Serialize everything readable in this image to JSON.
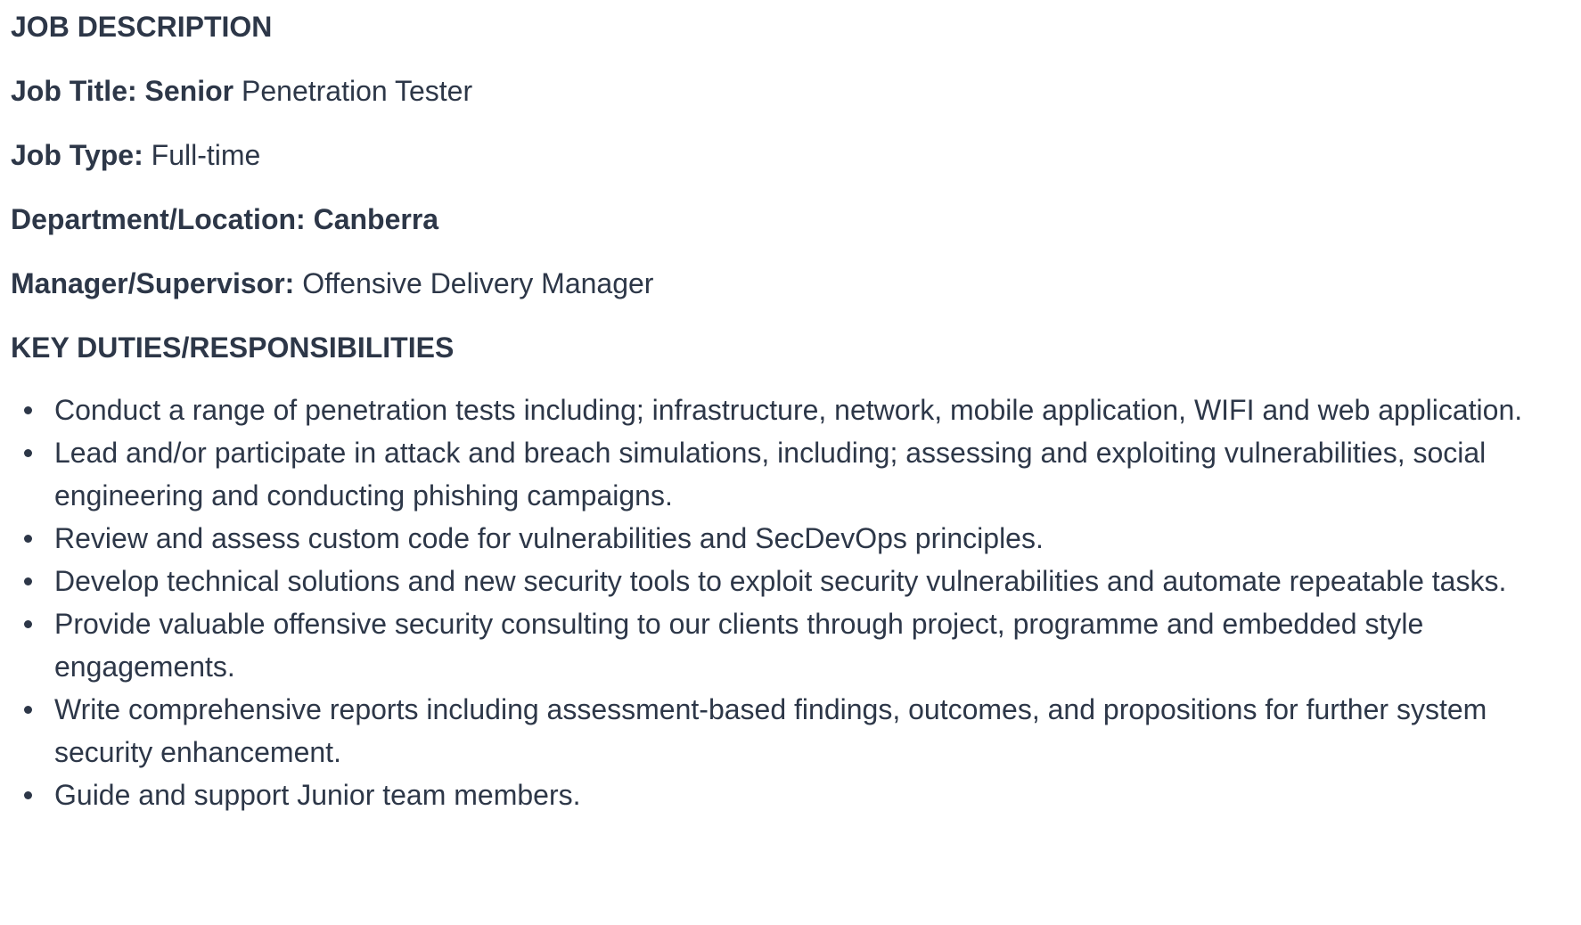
{
  "doc": {
    "heading": "JOB DESCRIPTION",
    "job_title": {
      "label": "Job Title:",
      "value_bold": "Senior",
      "value": "Penetration Tester"
    },
    "job_type": {
      "label": "Job Type:",
      "value": "Full-time"
    },
    "department": {
      "label": "Department/Location:",
      "value_bold": "Canberra"
    },
    "manager": {
      "label": "Manager/Supervisor:",
      "value": "Offensive Delivery Manager"
    },
    "duties_heading": "KEY DUTIES/RESPONSIBILITIES",
    "duties": [
      "Conduct a range of penetration tests including; infrastructure, network, mobile application, WIFI and web application.",
      "Lead and/or participate in attack and breach simulations, including; assessing and exploiting vulnerabilities, social engineering and conducting phishing campaigns.",
      "Review and assess custom code for vulnerabilities and SecDevOps principles.",
      "Develop technical solutions and new security tools to exploit security vulnerabilities and automate repeatable tasks.",
      "Provide valuable offensive security consulting to our clients through project, programme and embedded style engagements.",
      "Write comprehensive reports including assessment-based findings, outcomes, and propositions for further system security enhancement.",
      "Guide and support Junior team members."
    ]
  }
}
